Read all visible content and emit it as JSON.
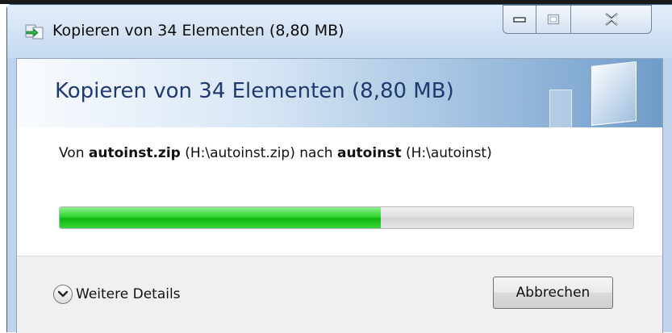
{
  "window": {
    "title": "Kopieren von 34 Elementen (8,80 MB)"
  },
  "controls": {
    "minimize_icon": "minimize-icon",
    "maximize_icon": "maximize-icon",
    "close_icon": "close-icon"
  },
  "banner": {
    "heading": "Kopieren von 34 Elementen (8,80 MB)"
  },
  "transfer": {
    "prefix": "Von",
    "source_name": "autoinst.zip",
    "source_path": "(H:\\autoinst.zip)",
    "middle": "nach",
    "dest_name": "autoinst",
    "dest_path": "(H:\\autoinst)"
  },
  "progress": {
    "fraction": 0.56,
    "color": "#22c922"
  },
  "footer": {
    "details_label": "Weitere Details",
    "details_icon": "chevron-down-icon",
    "cancel_label": "Abbrechen"
  }
}
